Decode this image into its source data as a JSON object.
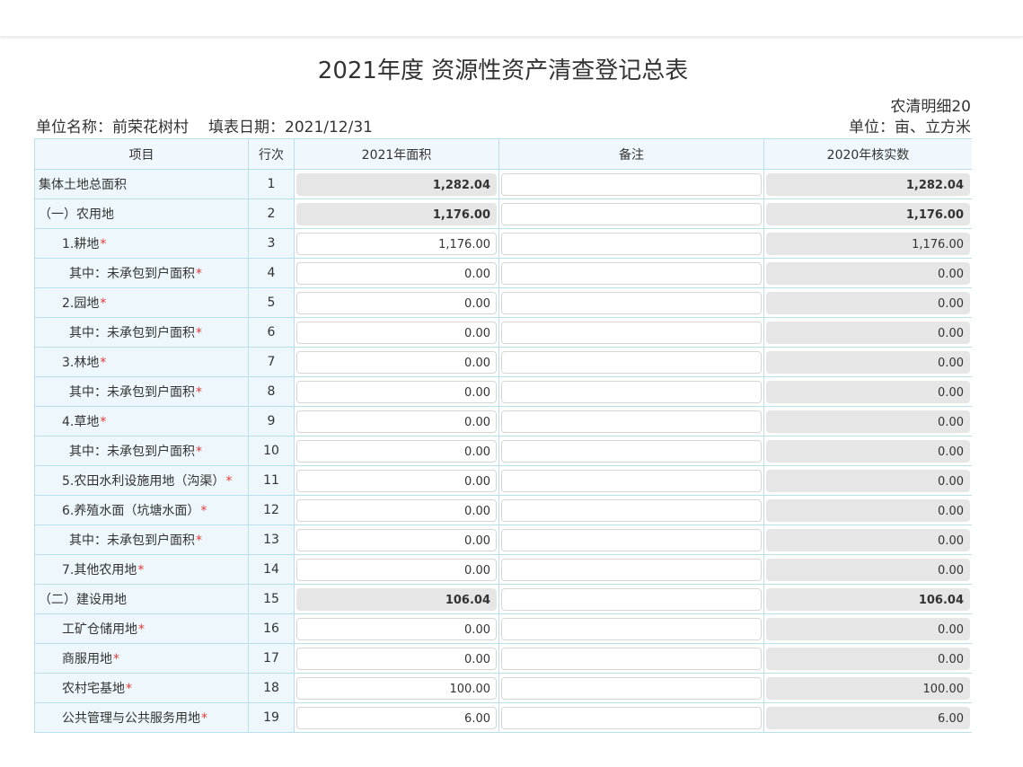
{
  "title": "2021年度 资源性资产清查登记总表",
  "report_code": "农清明细20",
  "unit_name_label": "单位名称：",
  "unit_name": "前荣花树村",
  "fill_date_label": "填表日期：",
  "fill_date": "2021/12/31",
  "unit_label": "单位：亩、立方米",
  "columns": [
    "项目",
    "行次",
    "2021年面积",
    "备注",
    "2020年核实数"
  ],
  "rows": [
    {
      "item": "集体土地总面积",
      "level": 1,
      "required": false,
      "line": "1",
      "area_2021": "1,282.04",
      "remark": "",
      "verified_2020": "1,282.04",
      "editable": false,
      "bold": true
    },
    {
      "item": "（一）农用地",
      "level": 1,
      "required": false,
      "line": "2",
      "area_2021": "1,176.00",
      "remark": "",
      "verified_2020": "1,176.00",
      "editable": false,
      "bold": true
    },
    {
      "item": "1.耕地",
      "level": 2,
      "required": true,
      "line": "3",
      "area_2021": "1,176.00",
      "remark": "",
      "verified_2020": "1,176.00",
      "editable": true,
      "bold": false
    },
    {
      "item": "其中：未承包到户面积",
      "level": 3,
      "required": true,
      "line": "4",
      "area_2021": "0.00",
      "remark": "",
      "verified_2020": "0.00",
      "editable": true,
      "bold": false
    },
    {
      "item": "2.园地",
      "level": 2,
      "required": true,
      "line": "5",
      "area_2021": "0.00",
      "remark": "",
      "verified_2020": "0.00",
      "editable": true,
      "bold": false
    },
    {
      "item": "其中：未承包到户面积",
      "level": 3,
      "required": true,
      "line": "6",
      "area_2021": "0.00",
      "remark": "",
      "verified_2020": "0.00",
      "editable": true,
      "bold": false
    },
    {
      "item": "3.林地",
      "level": 2,
      "required": true,
      "line": "7",
      "area_2021": "0.00",
      "remark": "",
      "verified_2020": "0.00",
      "editable": true,
      "bold": false
    },
    {
      "item": "其中：未承包到户面积",
      "level": 3,
      "required": true,
      "line": "8",
      "area_2021": "0.00",
      "remark": "",
      "verified_2020": "0.00",
      "editable": true,
      "bold": false
    },
    {
      "item": "4.草地",
      "level": 2,
      "required": true,
      "line": "9",
      "area_2021": "0.00",
      "remark": "",
      "verified_2020": "0.00",
      "editable": true,
      "bold": false
    },
    {
      "item": "其中：未承包到户面积",
      "level": 3,
      "required": true,
      "line": "10",
      "area_2021": "0.00",
      "remark": "",
      "verified_2020": "0.00",
      "editable": true,
      "bold": false
    },
    {
      "item": "5.农田水利设施用地（沟渠）",
      "level": 2,
      "required": true,
      "line": "11",
      "area_2021": "0.00",
      "remark": "",
      "verified_2020": "0.00",
      "editable": true,
      "bold": false
    },
    {
      "item": "6.养殖水面（坑塘水面）",
      "level": 2,
      "required": true,
      "line": "12",
      "area_2021": "0.00",
      "remark": "",
      "verified_2020": "0.00",
      "editable": true,
      "bold": false
    },
    {
      "item": "其中：未承包到户面积",
      "level": 3,
      "required": true,
      "line": "13",
      "area_2021": "0.00",
      "remark": "",
      "verified_2020": "0.00",
      "editable": true,
      "bold": false
    },
    {
      "item": "7.其他农用地",
      "level": 2,
      "required": true,
      "line": "14",
      "area_2021": "0.00",
      "remark": "",
      "verified_2020": "0.00",
      "editable": true,
      "bold": false
    },
    {
      "item": "（二）建设用地",
      "level": 1,
      "required": false,
      "line": "15",
      "area_2021": "106.04",
      "remark": "",
      "verified_2020": "106.04",
      "editable": false,
      "bold": true
    },
    {
      "item": "工矿仓储用地",
      "level": 2,
      "required": true,
      "line": "16",
      "area_2021": "0.00",
      "remark": "",
      "verified_2020": "0.00",
      "editable": true,
      "bold": false
    },
    {
      "item": "商服用地",
      "level": 2,
      "required": true,
      "line": "17",
      "area_2021": "0.00",
      "remark": "",
      "verified_2020": "0.00",
      "editable": true,
      "bold": false
    },
    {
      "item": "农村宅基地",
      "level": 2,
      "required": true,
      "line": "18",
      "area_2021": "100.00",
      "remark": "",
      "verified_2020": "100.00",
      "editable": true,
      "bold": false
    },
    {
      "item": "公共管理与公共服务用地",
      "level": 2,
      "required": true,
      "line": "19",
      "area_2021": "6.00",
      "remark": "",
      "verified_2020": "6.00",
      "editable": true,
      "bold": false
    }
  ],
  "required_mark": "*",
  "colors": {
    "header_bg": "#f0f8fd",
    "border": "#b9dfe9",
    "required": "#e53935",
    "readonly_bg": "#e6e6e6"
  }
}
